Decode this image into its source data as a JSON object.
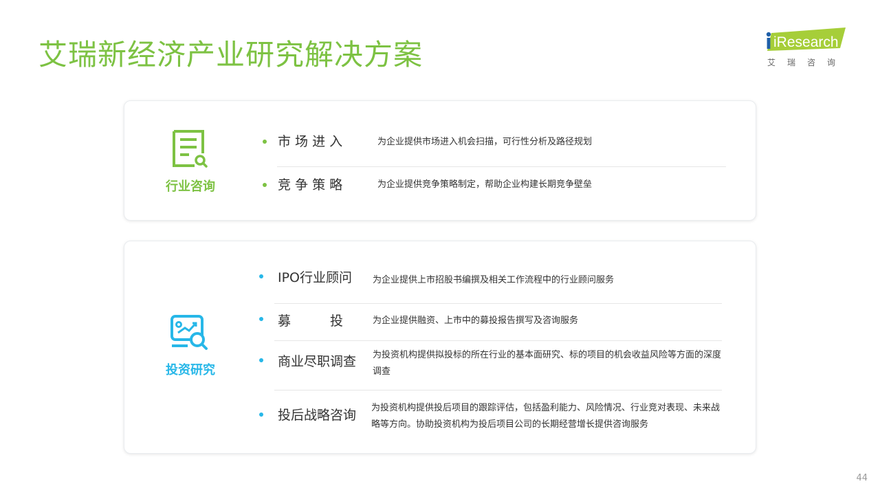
{
  "title": "艾瑞新经济产业研究解决方案",
  "logo": {
    "main": "iResearch",
    "sub": "艾瑞咨询"
  },
  "colors": {
    "green": "#7dc243",
    "blue": "#27b7e8",
    "text": "#333333"
  },
  "sections": [
    {
      "label": "行业咨询",
      "icon": "document-search-icon",
      "items": [
        {
          "title": "市 场 进 入",
          "desc": "为企业提供市场进入机会扫描，可行性分析及路径规划"
        },
        {
          "title": "竞 争 策 略",
          "desc": "为企业提供竞争策略制定，帮助企业构建长期竞争壁垒"
        }
      ]
    },
    {
      "label": "投资研究",
      "icon": "chart-search-icon",
      "items": [
        {
          "title": "IPO行业顾问",
          "desc": "为企业提供上市招股书编撰及相关工作流程中的行业顾问服务"
        },
        {
          "title": "募　　　投",
          "desc": "为企业提供融资、上市中的募投报告撰写及咨询服务"
        },
        {
          "title": "商业尽职调查",
          "desc": "为投资机构提供拟投标的所在行业的基本面研究、标的项目的机会收益风险等方面的深度调查"
        },
        {
          "title": "投后战略咨询",
          "desc": "为投资机构提供投后项目的跟踪评估，包括盈利能力、风险情况、行业竞对表现、未来战略等方向。协助投资机构为投后项目公司的长期经营增长提供咨询服务"
        }
      ]
    }
  ],
  "page_number": "44"
}
